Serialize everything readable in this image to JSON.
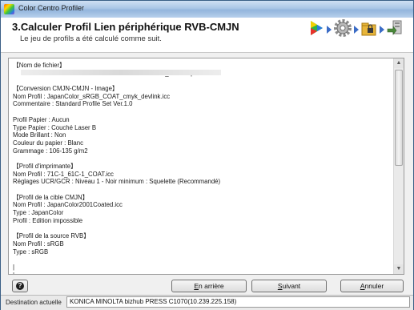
{
  "window": {
    "title": "Color Centro Profiler"
  },
  "header": {
    "step": "3.",
    "title": "Calculer Profil Lien périphérique RVB-CMJN",
    "subtitle": "Le jeu de profils a été calculé comme suit."
  },
  "workflow_icons": [
    "play-triangle-icon",
    "gear-icon",
    "lock-folder-icon",
    "export-icon"
  ],
  "content": {
    "lines": [
      "【Nom de fichier】",
      "                                                                                RGB_COAT1.pfs",
      "",
      "【Conversion CMJN-CMJN - Image】",
      "Nom Profil : JapanColor_sRGB_COAT_cmyk_devlink.icc",
      "Commentaire : Standard Profile Set Ver.1.0",
      "",
      "Profil Papier : Aucun",
      "Type Papier : Couché Laser B",
      "Mode Brillant : Non",
      "Couleur du papier : Blanc",
      "Grammage : 106-135 g/m2",
      "",
      "【Profil d'imprimante】",
      "Nom Profil : 71C-1_61C-1_COAT.icc",
      "Réglages UCR/GCR : Niveau 1 - Noir minimum : Squelette (Recommandé)",
      "",
      "【Profil de la cible CMJN】",
      "Nom Profil : JapanColor2001Coated.icc",
      "Type : JapanColor",
      "Profil : Edition impossible",
      "",
      "【Profil de la source RVB】",
      "Nom Profil : sRGB",
      "Type : sRGB",
      "",
      "|",
      "|"
    ]
  },
  "buttons": {
    "back": "En arrière",
    "next": "Suivant",
    "cancel": "Annuler"
  },
  "status": {
    "label": "Destination actuelle",
    "value": "KONICA MINOLTA bizhub PRESS C1070(10.239.225.158)"
  }
}
